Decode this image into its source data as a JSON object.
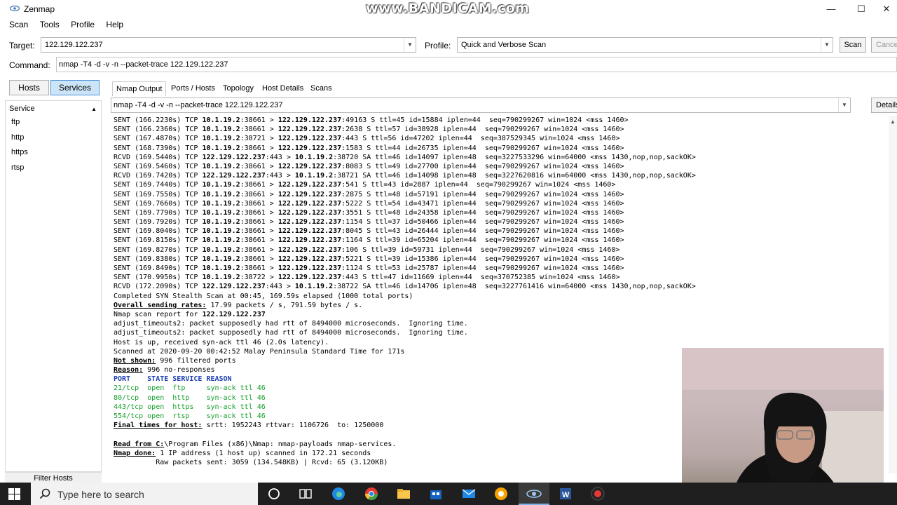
{
  "window": {
    "title": "Zenmap",
    "watermark": "www.BANDICAM.com"
  },
  "menu": [
    "Scan",
    "Tools",
    "Profile",
    "Help"
  ],
  "target": {
    "label": "Target:",
    "value": "122.129.122.237"
  },
  "profile": {
    "label": "Profile:",
    "value": "Quick and Verbose Scan"
  },
  "scan_button": "Scan",
  "cancel_button": "Cance",
  "command": {
    "label": "Command:",
    "value": "nmap -T4 -d -v -n --packet-trace 122.129.122.237"
  },
  "left_tabs": {
    "hosts": "Hosts",
    "services": "Services"
  },
  "services": {
    "header": "Service",
    "items": [
      "ftp",
      "http",
      "https",
      "rtsp"
    ]
  },
  "filter_hosts": "Filter Hosts",
  "tabs": [
    "Nmap Output",
    "Ports / Hosts",
    "Topology",
    "Host Details",
    "Scans"
  ],
  "output_command": "nmap -T4 -d -v -n --packet-trace 122.129.122.237",
  "details_button": "Details",
  "packets": [
    [
      "SENT (166.2230s) TCP ",
      "10.1.19.2",
      ":38661 > ",
      "122.129.122.237",
      ":49163 S ttl=45 id=15884 iplen=44  seq=790299267 win=1024 <mss 1460>"
    ],
    [
      "SENT (166.2360s) TCP ",
      "10.1.19.2",
      ":38661 > ",
      "122.129.122.237",
      ":2638 S ttl=57 id=38928 iplen=44  seq=790299267 win=1024 <mss 1460>"
    ],
    [
      "SENT (167.4870s) TCP ",
      "10.1.19.2",
      ":38721 > ",
      "122.129.122.237",
      ":443 S ttl=56 id=47202 iplen=44  seq=387529345 win=1024 <mss 1460>"
    ],
    [
      "SENT (168.7390s) TCP ",
      "10.1.19.2",
      ":38661 > ",
      "122.129.122.237",
      ":1583 S ttl=44 id=26735 iplen=44  seq=790299267 win=1024 <mss 1460>"
    ],
    [
      "RCVD (169.5440s) TCP ",
      "122.129.122.237",
      ":443 > ",
      "10.1.19.2",
      ":38720 SA ttl=46 id=14097 iplen=48  seq=3227533296 win=64000 <mss 1430,nop,nop,sackOK>"
    ],
    [
      "SENT (169.5460s) TCP ",
      "10.1.19.2",
      ":38661 > ",
      "122.129.122.237",
      ":8083 S ttl=49 id=27700 iplen=44  seq=790299267 win=1024 <mss 1460>"
    ],
    [
      "RCVD (169.7420s) TCP ",
      "122.129.122.237",
      ":443 > ",
      "10.1.19.2",
      ":38721 SA ttl=46 id=14098 iplen=48  seq=3227620816 win=64000 <mss 1430,nop,nop,sackOK>"
    ],
    [
      "SENT (169.7440s) TCP ",
      "10.1.19.2",
      ":38661 > ",
      "122.129.122.237",
      ":541 S ttl=43 id=2887 iplen=44  seq=790299267 win=1024 <mss 1460>"
    ],
    [
      "SENT (169.7550s) TCP ",
      "10.1.19.2",
      ":38661 > ",
      "122.129.122.237",
      ":2875 S ttl=48 id=57191 iplen=44  seq=790299267 win=1024 <mss 1460>"
    ],
    [
      "SENT (169.7660s) TCP ",
      "10.1.19.2",
      ":38661 > ",
      "122.129.122.237",
      ":5222 S ttl=54 id=43471 iplen=44  seq=790299267 win=1024 <mss 1460>"
    ],
    [
      "SENT (169.7790s) TCP ",
      "10.1.19.2",
      ":38661 > ",
      "122.129.122.237",
      ":3551 S ttl=48 id=24358 iplen=44  seq=790299267 win=1024 <mss 1460>"
    ],
    [
      "SENT (169.7920s) TCP ",
      "10.1.19.2",
      ":38661 > ",
      "122.129.122.237",
      ":1154 S ttl=37 id=50466 iplen=44  seq=790299267 win=1024 <mss 1460>"
    ],
    [
      "SENT (169.8040s) TCP ",
      "10.1.19.2",
      ":38661 > ",
      "122.129.122.237",
      ":8045 S ttl=43 id=26444 iplen=44  seq=790299267 win=1024 <mss 1460>"
    ],
    [
      "SENT (169.8150s) TCP ",
      "10.1.19.2",
      ":38661 > ",
      "122.129.122.237",
      ":1164 S ttl=39 id=65204 iplen=44  seq=790299267 win=1024 <mss 1460>"
    ],
    [
      "SENT (169.8270s) TCP ",
      "10.1.19.2",
      ":38661 > ",
      "122.129.122.237",
      ":106 S ttl=39 id=59731 iplen=44  seq=790299267 win=1024 <mss 1460>"
    ],
    [
      "SENT (169.8380s) TCP ",
      "10.1.19.2",
      ":38661 > ",
      "122.129.122.237",
      ":5221 S ttl=39 id=15386 iplen=44  seq=790299267 win=1024 <mss 1460>"
    ],
    [
      "SENT (169.8490s) TCP ",
      "10.1.19.2",
      ":38661 > ",
      "122.129.122.237",
      ":1124 S ttl=53 id=25787 iplen=44  seq=790299267 win=1024 <mss 1460>"
    ],
    [
      "SENT (170.9950s) TCP ",
      "10.1.19.2",
      ":38722 > ",
      "122.129.122.237",
      ":443 S ttl=47 id=11669 iplen=44  seq=370752385 win=1024 <mss 1460>"
    ],
    [
      "RCVD (172.2090s) TCP ",
      "122.129.122.237",
      ":443 > ",
      "10.1.19.2",
      ":38722 SA ttl=46 id=14706 iplen=48  seq=3227761416 win=64000 <mss 1430,nop,nop,sackOK>"
    ]
  ],
  "summary": {
    "completed": "Completed SYN Stealth Scan at 00:45, 169.59s elapsed (1000 total ports)",
    "rates_label": "Overall sending rates:",
    "rates_value": " 17.99 packets / s, 791.59 bytes / s.",
    "report_prefix": "Nmap scan report for ",
    "report_host": "122.129.122.237",
    "adjust1": "adjust_timeouts2: packet supposedly had rtt of 8494000 microseconds.  Ignoring time.",
    "adjust2": "adjust_timeouts2: packet supposedly had rtt of 8494000 microseconds.  Ignoring time.",
    "host_up": "Host is up, received syn-ack ttl 46 (2.0s latency).",
    "scanned_at": "Scanned at 2020-09-20 00:42:52 Malay Peninsula Standard Time for 171s",
    "not_shown_label": "Not shown:",
    "not_shown_value": " 996 filtered ports",
    "reason_label": "Reason:",
    "reason_value": " 996 no-responses",
    "port_header": "PORT    STATE SERVICE REASON",
    "ports": [
      "21/tcp  open  ftp     syn-ack ttl 46",
      "80/tcp  open  http    syn-ack ttl 46",
      "443/tcp open  https   syn-ack ttl 46",
      "554/tcp open  rtsp    syn-ack ttl 46"
    ],
    "final_label": "Final times for host:",
    "final_value": " srtt: 1952243 rttvar: 1106726  to: 1250000",
    "read_label": "Read from C:",
    "read_value": "\\Program Files (x86)\\Nmap: nmap-payloads nmap-services.",
    "done_label": "Nmap done:",
    "done_value": " 1 IP address (1 host up) scanned in 172.21 seconds",
    "raw_packets": "          Raw packets sent: 3059 (134.548KB) | Rcvd: 65 (3.120KB)"
  },
  "taskbar": {
    "search_placeholder": "Type here to search"
  },
  "colors": {
    "accent": "#4a90d9",
    "green": "#14a02a",
    "header_blue": "#1d3fb3",
    "taskbar": "#1f1f1f"
  }
}
